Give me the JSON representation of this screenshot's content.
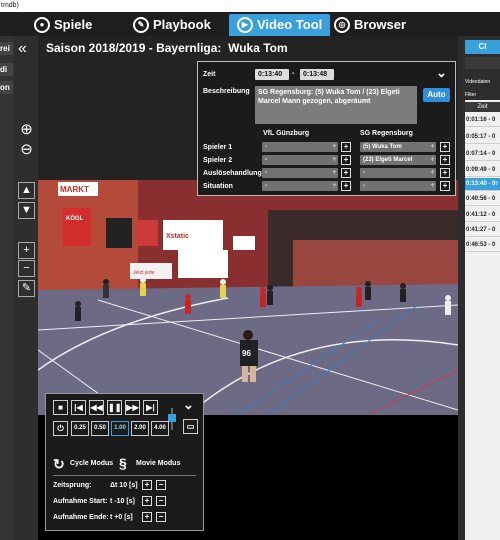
{
  "window": {
    "title_fragment": "tmdb)"
  },
  "tabs": [
    {
      "label": "Spiele",
      "icon": "soccer-ball-icon",
      "active": false
    },
    {
      "label": "Playbook",
      "icon": "playbook-icon",
      "active": false
    },
    {
      "label": "Video Tool",
      "icon": "play-icon",
      "active": true
    },
    {
      "label": "Browser",
      "icon": "globe-icon",
      "active": false
    }
  ],
  "left_buttons": [
    "rei",
    "di",
    "on"
  ],
  "header": {
    "title": "Saison 2018/2019 - Bayernliga:",
    "player": "Wuka Tom"
  },
  "event_panel": {
    "zeit_label": "Zeit",
    "time_start": "0:13:40",
    "time_separator": "-",
    "time_end": "0:13:48",
    "beschreibung_label": "Beschreibung",
    "description": "SG Regensburg: (5) Wuka Tom / (23) Elgeti Marcel Mann gezogen, abgeräumt",
    "auto_label": "Auto",
    "team_left": "VfL Günzburg",
    "team_right": "SG Regensburg",
    "rows": [
      {
        "label": "Spieler 1",
        "left": "-",
        "right": "(5) Wuka Tom"
      },
      {
        "label": "Spieler 2",
        "left": "-",
        "right": "(23) Elgeti Marcel"
      },
      {
        "label": "Auslösehandlung",
        "left": "-",
        "right": "-"
      },
      {
        "label": "Situation",
        "left": "-",
        "right": "-"
      }
    ]
  },
  "controls": {
    "speeds": [
      "0.25",
      "0.50",
      "1.00",
      "2.00",
      "4.00"
    ],
    "active_speed": "1.00",
    "cycle_label": "Cycle Modus",
    "movie_label": "Movie Modus",
    "zeitsprung_label": "Zeitsprung:",
    "zeitsprung_value": "Δt 10 [s]",
    "aufnahme_start_label": "Aufnahme Start:",
    "aufnahme_start_value": "t -10 [s]",
    "aufnahme_ende_label": "Aufnahme Ende:",
    "aufnahme_ende_value": "t +0 [s]"
  },
  "right_panel": {
    "clip_button": "Cl",
    "videodaten_label": "Videodaten",
    "filter_label": "Filter",
    "zeit_header": "Zeit",
    "clips": [
      "0:01:16 - 0",
      "0:05:17 - 0",
      "0:07:14 - 0",
      "0:09:49 - 0",
      "0:13:40 - 0",
      "0:40:56 - 0",
      "0:41:12 - 0",
      "0:41:27 - 0",
      "0:46:53 - 0"
    ],
    "selected_index": 4
  },
  "video": {
    "banners": [
      "MARKT",
      "KÖGL",
      "Jetzt jede",
      "Xstatic"
    ],
    "jersey_number": "96"
  },
  "colors": {
    "accent": "#3aa0dc",
    "court": "#6d6a86"
  }
}
